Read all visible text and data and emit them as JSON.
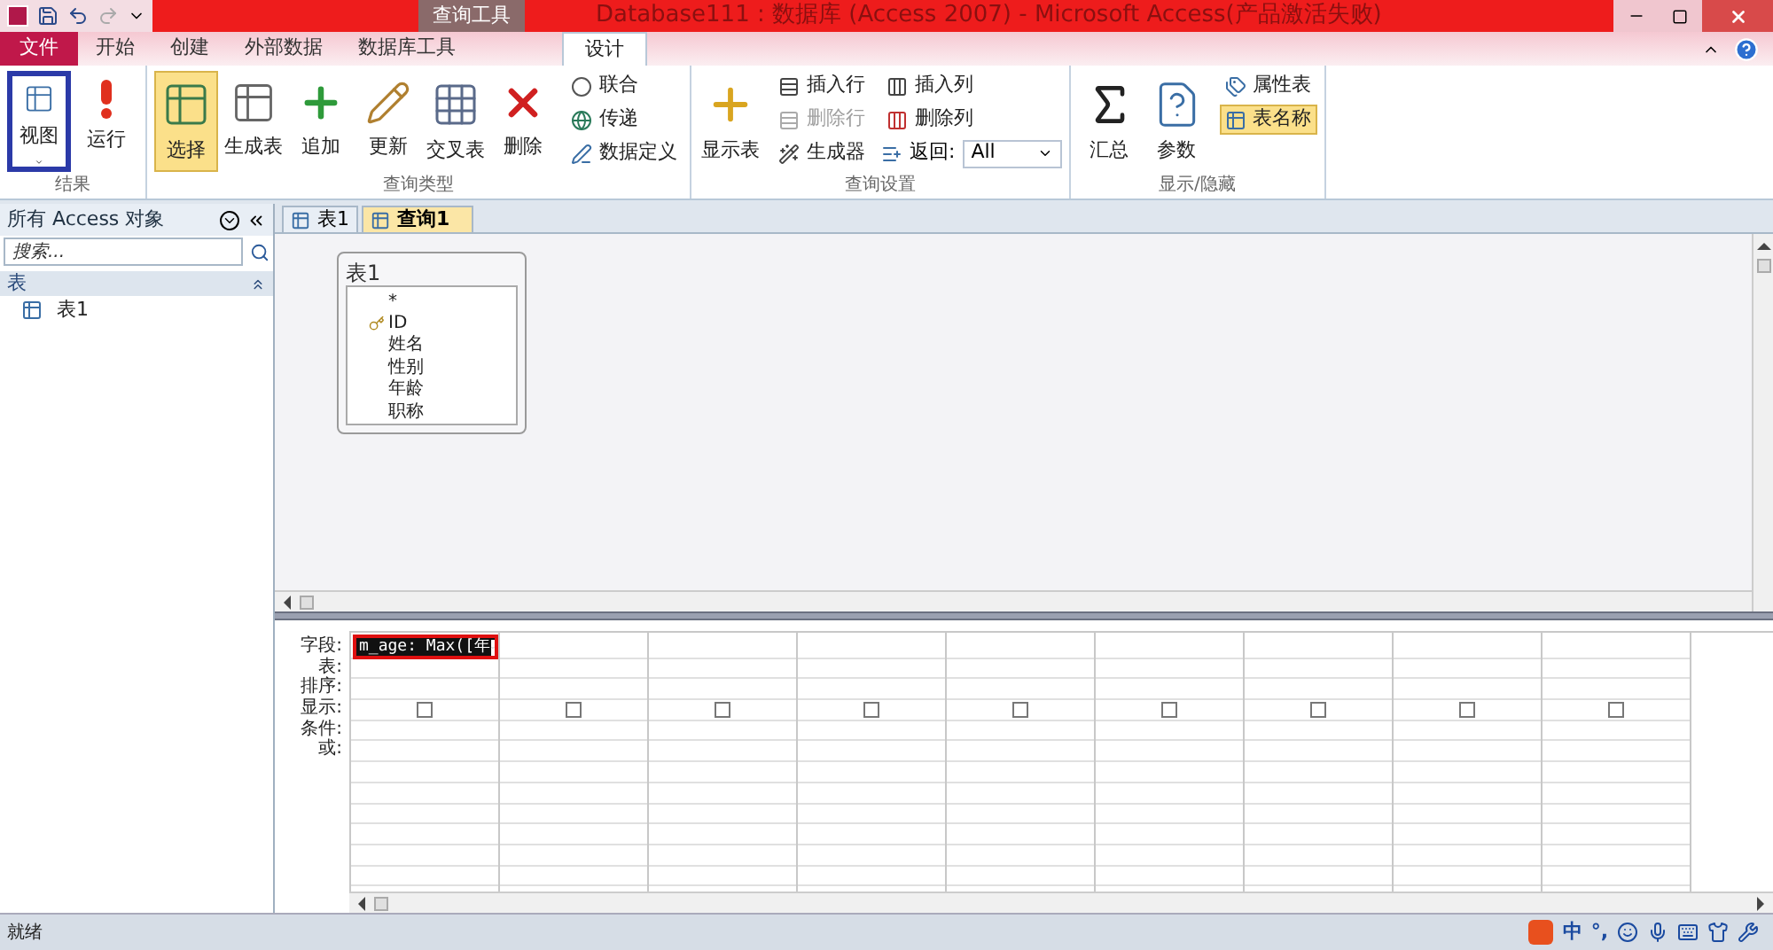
{
  "title_bar": {
    "title": "Database111 : 数据库 (Access 2007) - Microsoft Access(产品激活失败)",
    "context_tab": "查询工具"
  },
  "ribbon_tabs": [
    {
      "label": "文件",
      "kind": "file",
      "selected": false
    },
    {
      "label": "开始",
      "kind": "tab",
      "selected": false
    },
    {
      "label": "创建",
      "kind": "tab",
      "selected": false
    },
    {
      "label": "外部数据",
      "kind": "tab",
      "selected": false
    },
    {
      "label": "数据库工具",
      "kind": "tab",
      "selected": false
    },
    {
      "label": "设计",
      "kind": "tab",
      "selected": true
    }
  ],
  "ribbon_groups": [
    {
      "label": "结果",
      "items": [
        {
          "kind": "large",
          "label": "视图",
          "selected": false,
          "focused": true,
          "disabled": false
        },
        {
          "kind": "large",
          "label": "运行",
          "selected": false,
          "focused": false,
          "disabled": false
        }
      ]
    },
    {
      "label": "查询类型",
      "items": [
        {
          "kind": "large",
          "label": "选择",
          "selected": true,
          "focused": false,
          "disabled": false
        },
        {
          "kind": "large",
          "label": "生成表",
          "selected": false,
          "focused": false,
          "disabled": false
        },
        {
          "kind": "large",
          "label": "追加",
          "selected": false,
          "focused": false,
          "disabled": false
        },
        {
          "kind": "large",
          "label": "更新",
          "selected": false,
          "focused": false,
          "disabled": false
        },
        {
          "kind": "large",
          "label": "交叉表",
          "selected": false,
          "focused": false,
          "disabled": false
        },
        {
          "kind": "large",
          "label": "删除",
          "selected": false,
          "focused": false,
          "disabled": false
        },
        {
          "kind": "column",
          "children": [
            {
              "kind": "small",
              "label": "联合",
              "selected": false,
              "focused": false,
              "disabled": false
            },
            {
              "kind": "small",
              "label": "传递",
              "selected": false,
              "focused": false,
              "disabled": false
            },
            {
              "kind": "small",
              "label": "数据定义",
              "selected": false,
              "focused": false,
              "disabled": false
            }
          ]
        }
      ]
    },
    {
      "label": "查询设置",
      "items": [
        {
          "kind": "large",
          "label": "显示表",
          "selected": false,
          "focused": false,
          "disabled": false
        },
        {
          "kind": "column",
          "children": [
            {
              "kind": "small",
              "label": "插入行",
              "selected": false,
              "focused": false,
              "disabled": false
            },
            {
              "kind": "small",
              "label": "删除行",
              "selected": false,
              "focused": false,
              "disabled": true
            },
            {
              "kind": "small",
              "label": "生成器",
              "selected": false,
              "focused": false,
              "disabled": false
            }
          ]
        },
        {
          "kind": "column",
          "children": [
            {
              "kind": "small",
              "label": "插入列",
              "selected": false,
              "focused": false,
              "disabled": false
            },
            {
              "kind": "small",
              "label": "删除列",
              "selected": false,
              "focused": false,
              "disabled": false
            },
            {
              "kind": "combo",
              "label": "返回:",
              "value": "All"
            }
          ]
        }
      ]
    },
    {
      "label": "显示/隐藏",
      "items": [
        {
          "kind": "large",
          "label": "汇总",
          "selected": false,
          "focused": false,
          "disabled": false
        },
        {
          "kind": "large",
          "label": "参数",
          "selected": false,
          "focused": false,
          "disabled": false
        },
        {
          "kind": "column",
          "children": [
            {
              "kind": "small",
              "label": "属性表",
              "selected": false,
              "focused": false,
              "disabled": false
            },
            {
              "kind": "small",
              "label": "表名称",
              "selected": true,
              "focused": false,
              "disabled": false
            }
          ]
        }
      ]
    }
  ],
  "nav_pane": {
    "title": "所有 Access 对象",
    "search": {
      "placeholder": "搜索..."
    },
    "category": {
      "label": "表",
      "expanded": true,
      "items": [
        {
          "label": "表1"
        }
      ]
    }
  },
  "doc_tabs": [
    {
      "label": "表1",
      "selected": false
    },
    {
      "label": "查询1",
      "selected": true
    }
  ],
  "table_box": {
    "title": "表1",
    "fields": [
      {
        "label": "*",
        "primary_key": false
      },
      {
        "label": "ID",
        "primary_key": true
      },
      {
        "label": "姓名",
        "primary_key": false
      },
      {
        "label": "性别",
        "primary_key": false
      },
      {
        "label": "年龄",
        "primary_key": false
      },
      {
        "label": "职称",
        "primary_key": false
      }
    ]
  },
  "grid": {
    "row_labels": [
      "字段:",
      "表:",
      "排序:",
      "显示:",
      "条件:",
      "或:"
    ],
    "columns": [
      {
        "field": "m_age: Max([年",
        "active": true,
        "show": false
      },
      {
        "active": false,
        "show": false
      },
      {
        "active": false,
        "show": false
      },
      {
        "active": false,
        "show": false
      },
      {
        "active": false,
        "show": false
      },
      {
        "active": false,
        "show": false
      },
      {
        "active": false,
        "show": false
      },
      {
        "active": false,
        "show": false
      },
      {
        "active": false,
        "show": false
      }
    ]
  },
  "status_bar": {
    "text": "就绪",
    "ime": [
      "中",
      "°,"
    ]
  }
}
